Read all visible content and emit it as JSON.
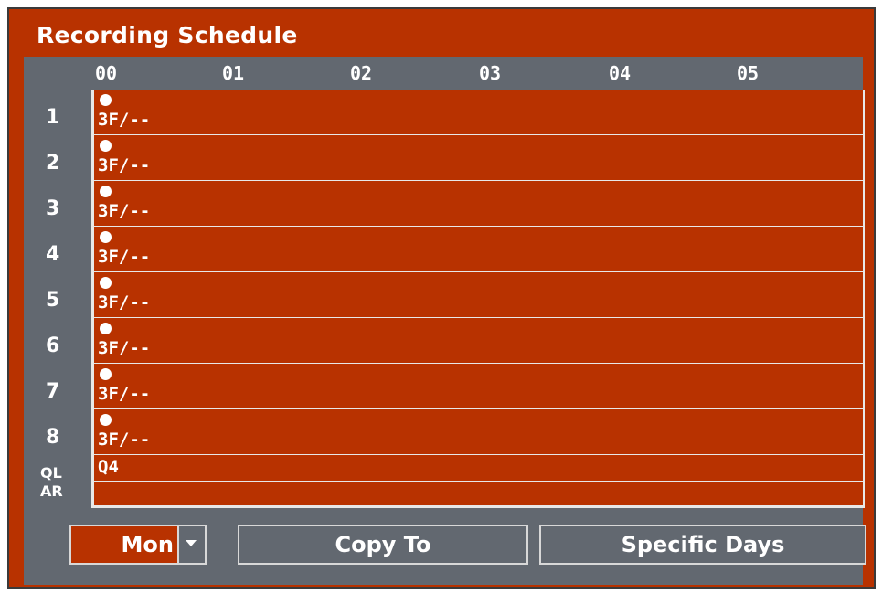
{
  "window": {
    "title": "Recording Schedule"
  },
  "hours": [
    "00",
    "01",
    "02",
    "03",
    "04",
    "05"
  ],
  "channels": [
    {
      "label": "1",
      "cell": "3F/--"
    },
    {
      "label": "2",
      "cell": "3F/--"
    },
    {
      "label": "3",
      "cell": "3F/--"
    },
    {
      "label": "4",
      "cell": "3F/--"
    },
    {
      "label": "5",
      "cell": "3F/--"
    },
    {
      "label": "6",
      "cell": "3F/--"
    },
    {
      "label": "7",
      "cell": "3F/--"
    },
    {
      "label": "8",
      "cell": "3F/--"
    }
  ],
  "extra_rows": {
    "ql": {
      "label": "QL",
      "cell": "Q4"
    },
    "ar": {
      "label": "AR",
      "cell": ""
    }
  },
  "controls": {
    "day": "Mon",
    "copy_to": "Copy To",
    "specific_days": "Specific Days"
  },
  "colors": {
    "schedule_red": "#b83200",
    "panel_gray": "#626870",
    "grid_line": "#e8e8e8"
  }
}
